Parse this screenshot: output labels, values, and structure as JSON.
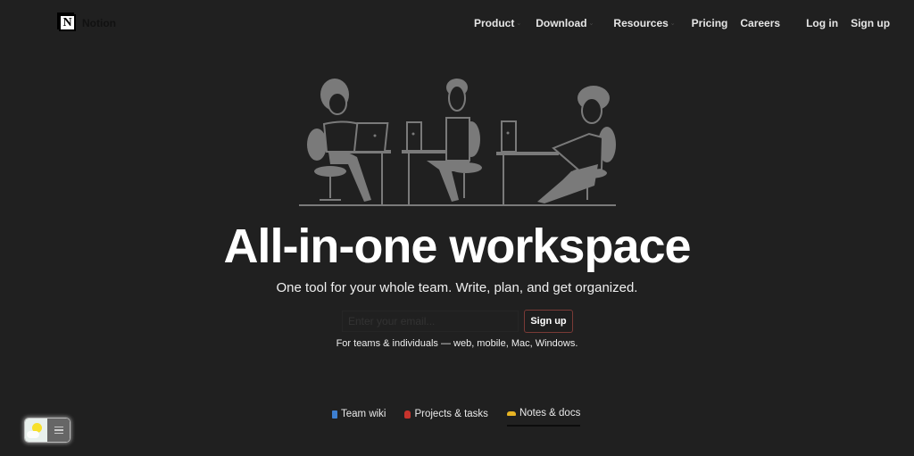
{
  "brand": {
    "name": "Notion",
    "logo_glyph": "N"
  },
  "nav": {
    "items": [
      {
        "label": "Product",
        "has_dropdown": true
      },
      {
        "label": "Download",
        "has_dropdown": true
      },
      {
        "label": "Resources",
        "has_dropdown": true
      },
      {
        "label": "Pricing",
        "has_dropdown": false
      },
      {
        "label": "Careers",
        "has_dropdown": false
      }
    ],
    "login_label": "Log in",
    "signup_label": "Sign up",
    "chevron_glyph": "⌄"
  },
  "hero": {
    "illustration_alt": "Three people working at desks with laptops",
    "headline": "All-in-one workspace",
    "subtitle": "One tool for your whole team. Write, plan, and get organized.",
    "email_placeholder": "Enter your email...",
    "email_value": "",
    "signup_button": "Sign up",
    "platforms_note": "For teams & individuals — web, mobile, Mac, Windows."
  },
  "tabs": [
    {
      "label": "Team wiki",
      "icon": "book-icon",
      "active": false
    },
    {
      "label": "Projects & tasks",
      "icon": "pin-icon",
      "active": false
    },
    {
      "label": "Notes & docs",
      "icon": "writing-hand-icon",
      "active": true
    }
  ],
  "theme_toggle": {
    "mode": "light",
    "icons": [
      "sun-icon",
      "menu-icon"
    ]
  },
  "colors": {
    "background": "#202020",
    "signup_border": "#7a3a36",
    "illustration": "#7a7a7a"
  }
}
